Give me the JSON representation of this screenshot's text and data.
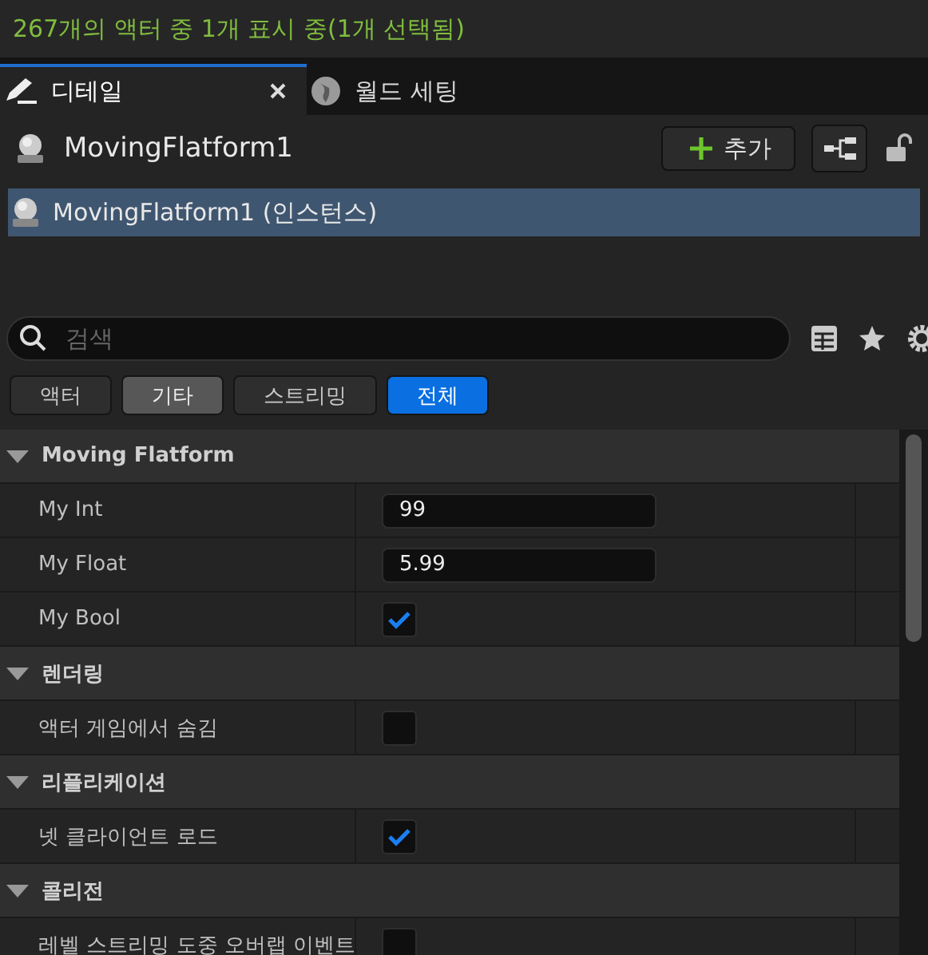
{
  "status": "267개의 액터 중 1개 표시 중(1개 선택됨)",
  "tabs": [
    {
      "label": "디테일",
      "selected": true
    },
    {
      "label": "월드 세팅",
      "selected": false
    }
  ],
  "actor": {
    "name": "MovingFlatform1",
    "add_button": "추가"
  },
  "components": [
    {
      "label": "MovingFlatform1 (인스턴스)",
      "selected": true
    }
  ],
  "search": {
    "placeholder": "검색"
  },
  "filters": [
    {
      "label": "액터",
      "selected": false,
      "highlighted": false
    },
    {
      "label": "기타",
      "selected": false,
      "highlighted": true
    },
    {
      "label": "스트리밍",
      "selected": false,
      "highlighted": false
    },
    {
      "label": "전체",
      "selected": true,
      "highlighted": false
    }
  ],
  "sections": [
    {
      "title": "Moving Flatform",
      "expanded": true,
      "properties": [
        {
          "name": "My Int",
          "kind": "text",
          "value": "99"
        },
        {
          "name": "My Float",
          "kind": "text",
          "value": "5.99"
        },
        {
          "name": "My Bool",
          "kind": "checkbox",
          "checked": true
        }
      ]
    },
    {
      "title": "렌더링",
      "expanded": true,
      "properties": [
        {
          "name": "액터 게임에서 숨김",
          "kind": "checkbox",
          "checked": false
        }
      ]
    },
    {
      "title": "리플리케이션",
      "expanded": true,
      "properties": [
        {
          "name": "넷 클라이언트 로드",
          "kind": "checkbox",
          "checked": true
        }
      ]
    },
    {
      "title": "콜리전",
      "expanded": true,
      "properties": [
        {
          "name": "레벨 스트리밍 도중 오버랩 이벤트",
          "kind": "checkbox",
          "checked": false
        }
      ]
    }
  ]
}
